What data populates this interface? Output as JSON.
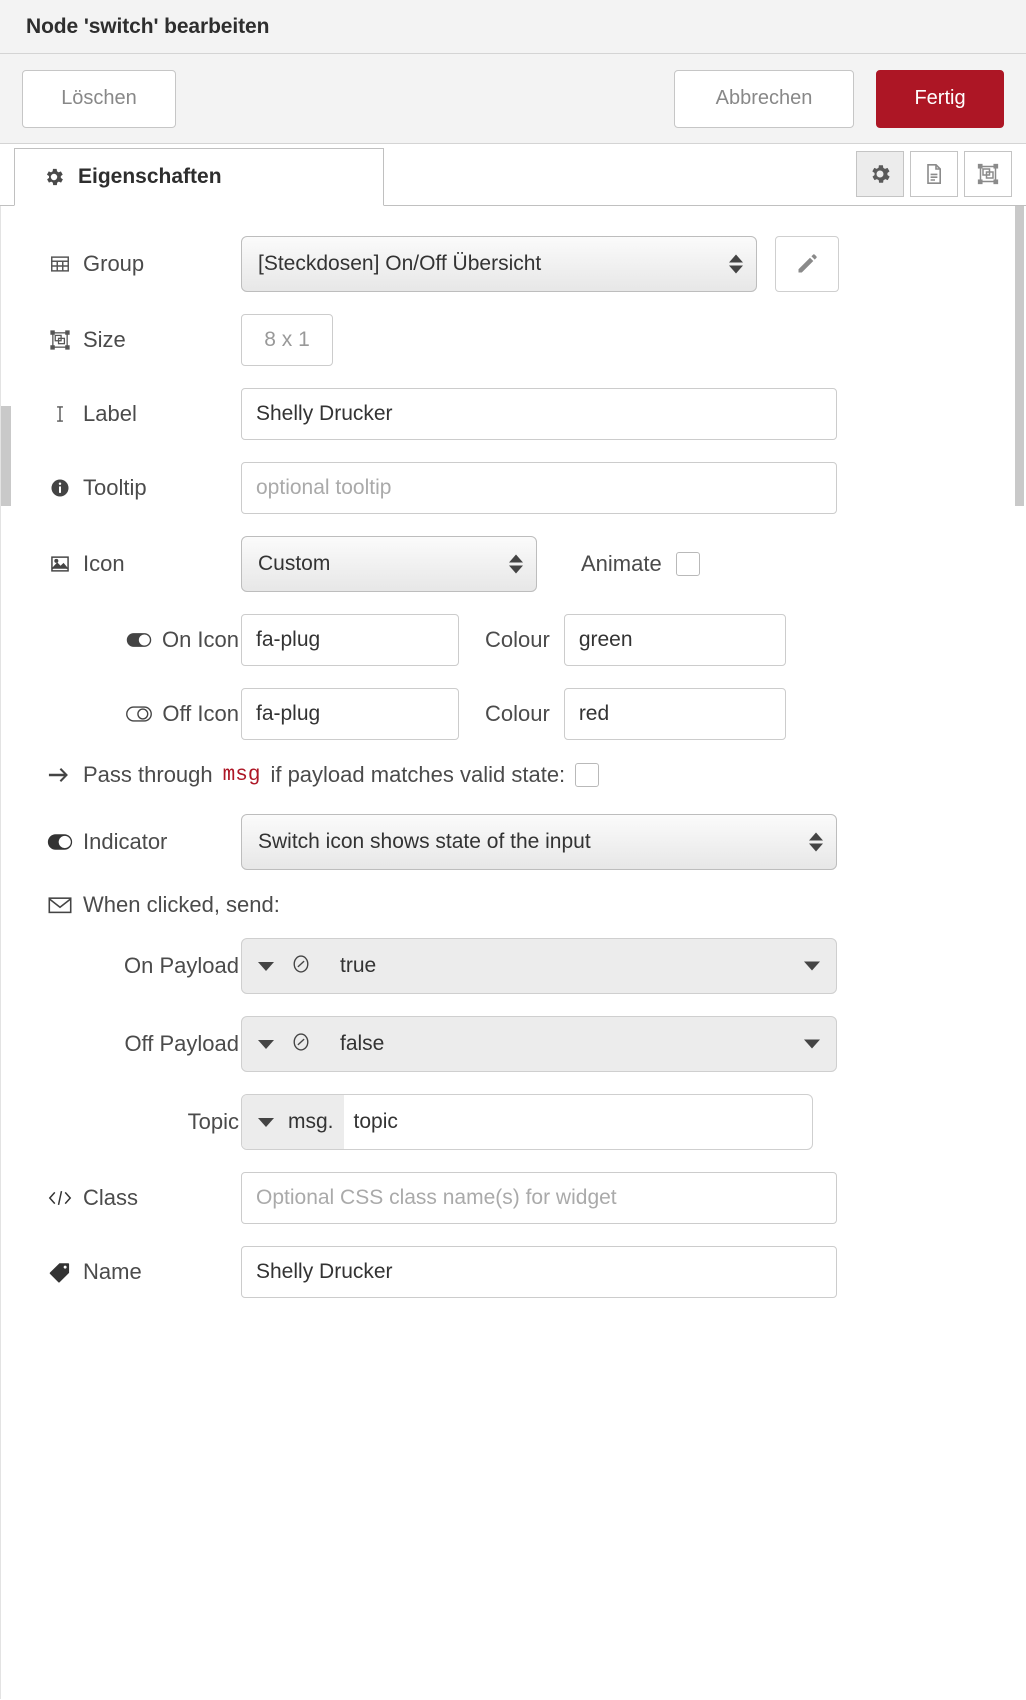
{
  "window": {
    "title": "Node 'switch' bearbeiten"
  },
  "buttons": {
    "delete": "Löschen",
    "cancel": "Abbrechen",
    "done": "Fertig"
  },
  "tabs": {
    "properties": "Eigenschaften",
    "icons": [
      "gear-icon",
      "description-icon",
      "layout-icon"
    ]
  },
  "form": {
    "group": {
      "label": "Group",
      "value": "[Steckdosen] On/Off Übersicht",
      "icon": "table-icon"
    },
    "size": {
      "label": "Size",
      "value": "8 x 1",
      "icon": "object-group-icon"
    },
    "label_field": {
      "label": "Label",
      "value": "Shelly Drucker",
      "icon": "text-cursor-icon"
    },
    "tooltip": {
      "label": "Tooltip",
      "value": "",
      "placeholder": "optional tooltip",
      "icon": "info-circle-icon"
    },
    "icon_select": {
      "label": "Icon",
      "value": "Custom",
      "icon": "image-icon",
      "animate_label": "Animate",
      "animate_checked": false
    },
    "on_icon": {
      "label": "On Icon",
      "value": "fa-plug",
      "icon": "toggle-on-icon",
      "colour_label": "Colour",
      "colour_value": "green"
    },
    "off_icon": {
      "label": "Off Icon",
      "value": "fa-plug",
      "icon": "toggle-off-icon",
      "colour_label": "Colour",
      "colour_value": "red"
    },
    "passthrough": {
      "text_before": "Pass through",
      "token": "msg",
      "text_after": "if payload matches valid state:",
      "checked": false,
      "icon": "arrow-right-icon"
    },
    "indicator": {
      "label": "Indicator",
      "value": "Switch icon shows state of the input",
      "icon": "toggle-half-icon"
    },
    "when_clicked": {
      "label": "When clicked, send:",
      "icon": "envelope-icon"
    },
    "on_payload": {
      "label": "On Payload",
      "value": "true",
      "type_icon": "boolean-type-icon"
    },
    "off_payload": {
      "label": "Off Payload",
      "value": "false",
      "type_icon": "boolean-type-icon"
    },
    "topic": {
      "label": "Topic",
      "prefix": "msg.",
      "value": "topic"
    },
    "class_field": {
      "label": "Class",
      "value": "",
      "placeholder": "Optional CSS class name(s) for widget",
      "icon": "code-icon"
    },
    "name_field": {
      "label": "Name",
      "value": "Shelly Drucker",
      "icon": "tag-icon"
    }
  },
  "colors": {
    "accent_red": "#ad1625",
    "msg_token": "#ad1625",
    "panel_bg": "#f3f3f3"
  }
}
